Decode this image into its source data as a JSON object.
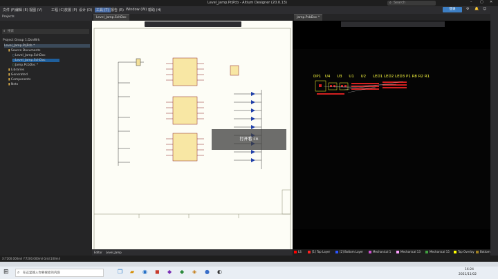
{
  "window": {
    "title": "Level_Jamp.PrjPcb - Altium Designer (20.0.13)",
    "search_placeholder": "Search"
  },
  "menu": [
    "文件 (F)",
    "编辑 (E)",
    "视图 (V)",
    "工程 (C)",
    "放置 (P)",
    "设计 (D)",
    "工具 (T)",
    "报告 (R)",
    "Window (W)",
    "帮助 (H)"
  ],
  "login_label": "登录",
  "doc_tabs": [
    "Level_Jamp.SchDoc",
    "Jamp.PcbDoc *"
  ],
  "projects": {
    "title": "Projects",
    "search_placeholder": "搜索",
    "tree": [
      "Project Group 1.DsnWrk",
      "Level_Jamp.PrjPcb *",
      "Source Documents",
      "Level_Jamp.SchDoc",
      "Level_Jamp.SchDoc",
      "Jamp.PcbDoc *",
      "Libraries",
      "Generated",
      "Components",
      "Nets"
    ]
  },
  "panel_tabs": [
    "Navigator",
    "SCH Filter",
    "Projects"
  ],
  "editor_tabs": [
    "Editor",
    "Level_Jamp"
  ],
  "pcb_components": [
    "DP1",
    "U4",
    "U3",
    "U1",
    "U2",
    "LED1",
    "LED2",
    "LED3",
    "P1",
    "R8",
    "R2",
    "R1"
  ],
  "layers": [
    {
      "name": "LS",
      "color": "#ff0000"
    },
    {
      "name": "[1] Top Layer",
      "color": "#ff2020"
    },
    {
      "name": "[2] Bottom Layer",
      "color": "#2b54ff"
    },
    {
      "name": "Mechanical 1",
      "color": "#d050d0"
    },
    {
      "name": "Mechanical 13",
      "color": "#ffa0ff"
    },
    {
      "name": "Mechanical 15",
      "color": "#40a040"
    },
    {
      "name": "Top Overlay",
      "color": "#ffff00"
    },
    {
      "name": "Bottom",
      "color": "#a08020"
    }
  ],
  "status_left": "X:7200.000mil Y:7200.000mil    Grid:100mil",
  "taskbar": {
    "search_placeholder": "在这里输入你要搜索的内容",
    "time": "16:24",
    "date": "2021/11/02"
  },
  "watermark": "打开看 cn"
}
